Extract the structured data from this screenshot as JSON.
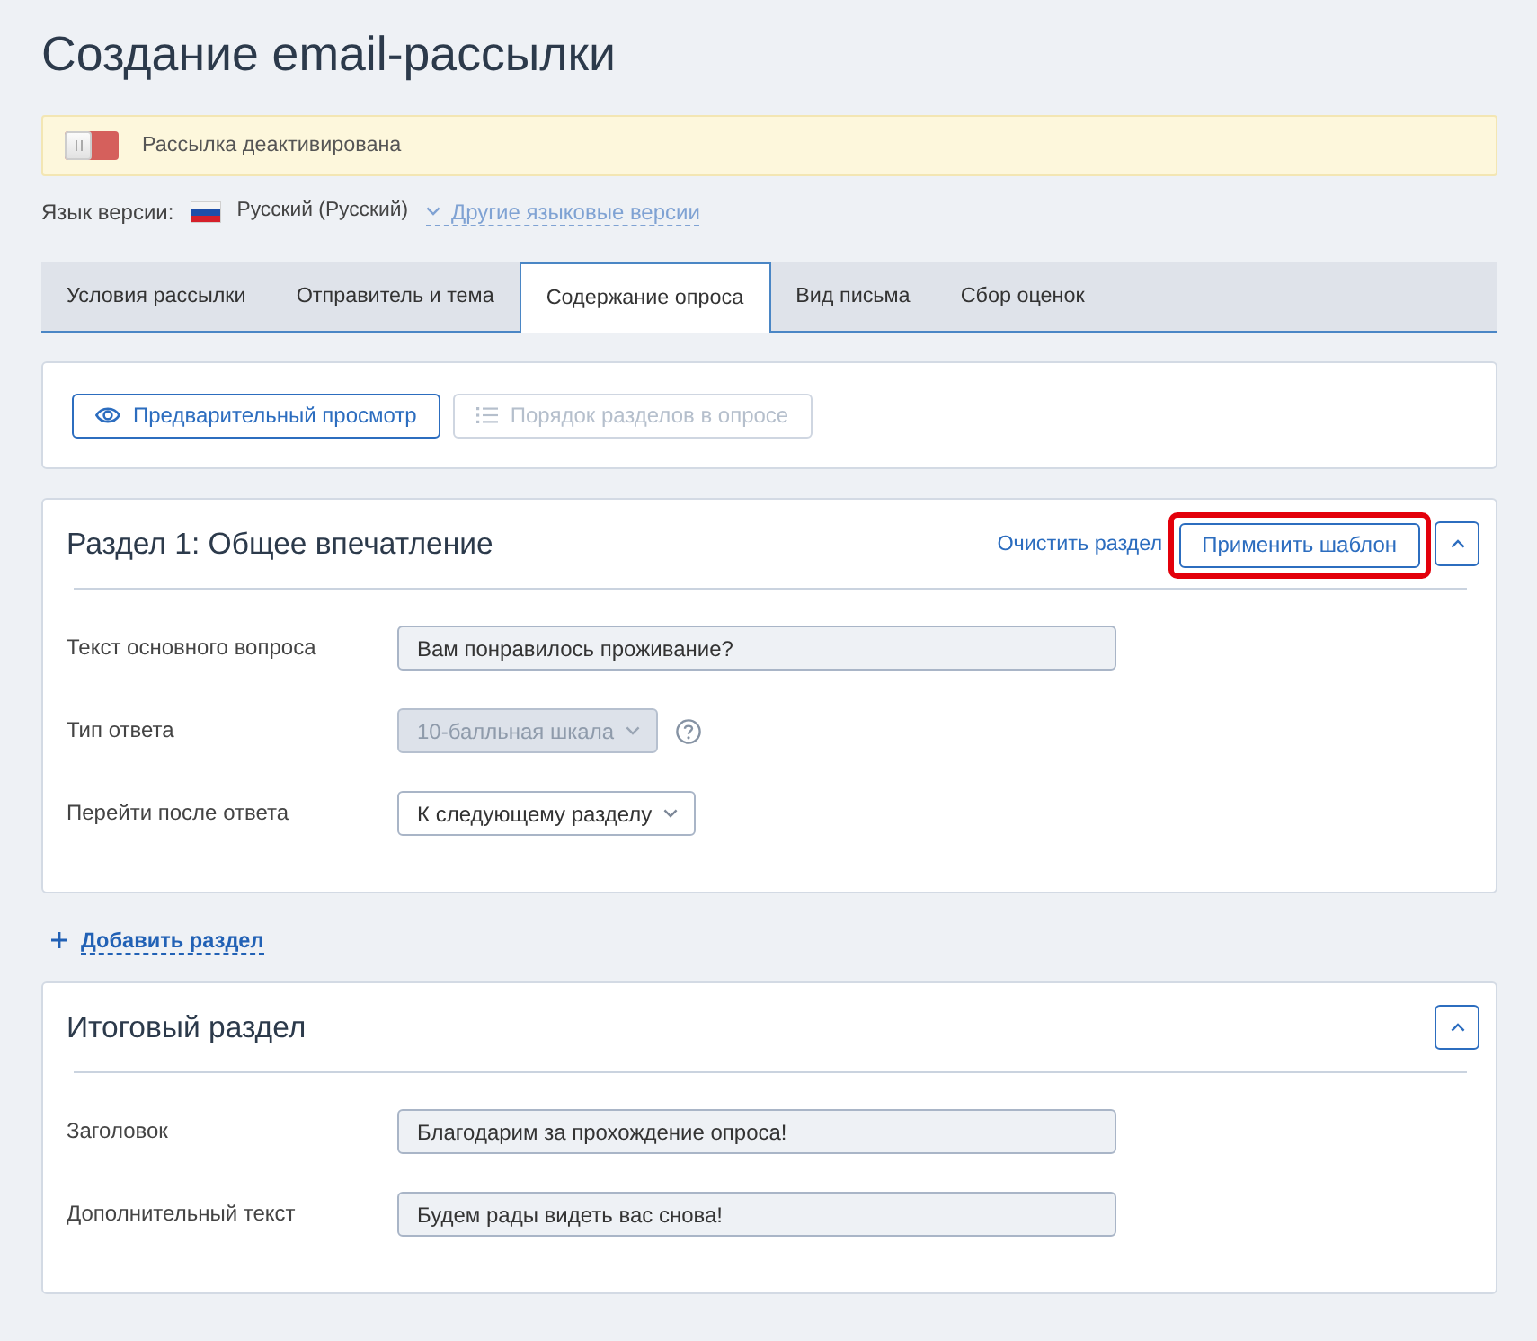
{
  "page": {
    "title": "Создание email-рассылки"
  },
  "status_alert": {
    "toggle_on": false,
    "text": "Рассылка деактивирована"
  },
  "language": {
    "label": "Язык версии:",
    "current": "Русский (Русский)",
    "other_versions_link": "Другие языковые версии"
  },
  "tabs": [
    {
      "label": "Условия рассылки",
      "selected": false
    },
    {
      "label": "Отправитель и тема",
      "selected": false
    },
    {
      "label": "Содержание опроса",
      "selected": true
    },
    {
      "label": "Вид письма",
      "selected": false
    },
    {
      "label": "Сбор оценок",
      "selected": false
    }
  ],
  "toolbar": {
    "buttons": [
      {
        "label": "Предварительный просмотр",
        "disabled": false
      },
      {
        "label": "Порядок разделов в опросе",
        "disabled": true
      }
    ]
  },
  "sections": [
    {
      "title": "Раздел 1: Общее впечатление",
      "clear_link": "Очистить раздел",
      "template_button": {
        "label": "Применить шаблон",
        "highlighted": true
      },
      "expanded": true,
      "fields": [
        {
          "kind": "text",
          "label": "Текст основного вопроса",
          "value": "Вам понравилось проживание?"
        },
        {
          "kind": "select",
          "label": "Тип ответа",
          "value": "10-балльная шкала",
          "disabled": true,
          "help": true
        },
        {
          "kind": "select",
          "label": "Перейти после ответа",
          "value": "К следующему разделу",
          "disabled": false
        }
      ]
    }
  ],
  "add_section_link": "Добавить раздел",
  "final_section": {
    "title": "Итоговый раздел",
    "expanded": true,
    "fields": [
      {
        "kind": "text",
        "label": "Заголовок",
        "value": "Благодарим за прохождение опроса!"
      },
      {
        "kind": "text",
        "label": "Дополнительный текст",
        "value": "Будем рады видеть вас снова!"
      }
    ]
  }
}
